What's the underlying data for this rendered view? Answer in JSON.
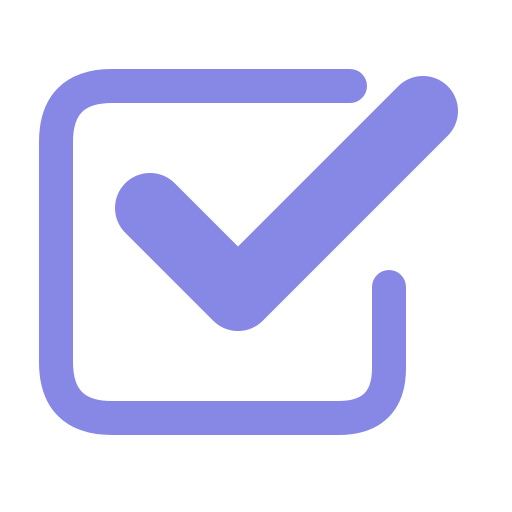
{
  "icon": {
    "name": "checkbox-checked-icon",
    "color": "#8787E6",
    "background": "#FFFFFF"
  }
}
